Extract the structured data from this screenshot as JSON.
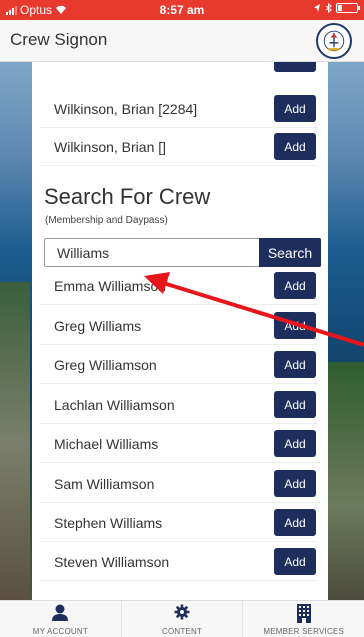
{
  "status_bar": {
    "carrier": "Optus",
    "time": "8:57 am"
  },
  "header": {
    "title": "Crew Signon",
    "logo_icon": "royal-geelong-yacht-club-logo"
  },
  "existing_crew": [
    {
      "name": "Wilkinson, Brian [2284]",
      "button": "Add"
    },
    {
      "name": "Wilkinson, Brian []",
      "button": "Add"
    }
  ],
  "search": {
    "title": "Search For Crew",
    "subtitle": "(Membership and Daypass)",
    "value": "Williams",
    "button": "Search"
  },
  "results": [
    {
      "name": "Emma Williamson",
      "button": "Add"
    },
    {
      "name": "Greg Williams",
      "button": "Add"
    },
    {
      "name": "Greg Williamson",
      "button": "Add"
    },
    {
      "name": "Lachlan Williamson",
      "button": "Add"
    },
    {
      "name": "Michael Williams",
      "button": "Add"
    },
    {
      "name": "Sam Williamson",
      "button": "Add"
    },
    {
      "name": "Stephen Williams",
      "button": "Add"
    },
    {
      "name": "Steven Williamson",
      "button": "Add"
    }
  ],
  "bottom_nav": [
    {
      "label": "MY ACCOUNT",
      "icon": "user-icon"
    },
    {
      "label": "CONTENT",
      "icon": "gear-icon"
    },
    {
      "label": "MEMBER SERVICES",
      "icon": "building-icon"
    }
  ],
  "colors": {
    "status_bar": "#e8392f",
    "button": "#1d2d5c",
    "annotation_arrow": "#e8161b"
  }
}
